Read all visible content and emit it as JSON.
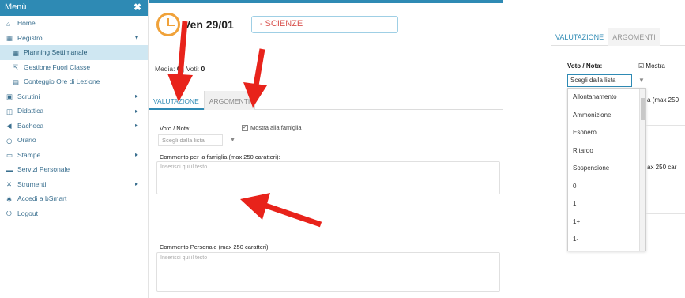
{
  "sidebar": {
    "title": "Menù",
    "close_icon": "close-icon",
    "items": [
      {
        "label": "Home",
        "icon": "home-icon",
        "sub": false,
        "active": false,
        "arrow": false
      },
      {
        "label": "Registro",
        "icon": "calendar-icon",
        "sub": false,
        "active": false,
        "arrow": true,
        "arrow_dir": "down"
      },
      {
        "label": "Planning Settimanale",
        "icon": "calendar-icon",
        "sub": true,
        "active": true,
        "arrow": false
      },
      {
        "label": "Gestione Fuori Classe",
        "icon": "external-link-icon",
        "sub": true,
        "active": false,
        "arrow": false
      },
      {
        "label": "Conteggio Ore di Lezione",
        "icon": "table-icon",
        "sub": true,
        "active": false,
        "arrow": false
      },
      {
        "label": "Scrutini",
        "icon": "document-icon",
        "sub": false,
        "active": false,
        "arrow": true,
        "arrow_dir": "right"
      },
      {
        "label": "Didattica",
        "icon": "book-icon",
        "sub": false,
        "active": false,
        "arrow": true,
        "arrow_dir": "right"
      },
      {
        "label": "Bacheca",
        "icon": "megaphone-icon",
        "sub": false,
        "active": false,
        "arrow": true,
        "arrow_dir": "right"
      },
      {
        "label": "Orario",
        "icon": "clock-icon",
        "sub": false,
        "active": false,
        "arrow": false
      },
      {
        "label": "Stampe",
        "icon": "printer-icon",
        "sub": false,
        "active": false,
        "arrow": true,
        "arrow_dir": "right"
      },
      {
        "label": "Servizi Personale",
        "icon": "folder-icon",
        "sub": false,
        "active": false,
        "arrow": false
      },
      {
        "label": "Strumenti",
        "icon": "tools-icon",
        "sub": false,
        "active": false,
        "arrow": true,
        "arrow_dir": "right"
      },
      {
        "label": "Accedi a bSmart",
        "icon": "star-icon",
        "sub": false,
        "active": false,
        "arrow": false
      },
      {
        "label": "Logout",
        "icon": "logout-icon",
        "sub": false,
        "active": false,
        "arrow": false
      }
    ]
  },
  "header": {
    "date": "Ven 29/01",
    "subject": "- SCIENZE"
  },
  "summary": {
    "media_label": "Media:",
    "media_value": "0",
    "sep": " | ",
    "voti_label": "Voti:",
    "voti_value": "0"
  },
  "tabs": {
    "valutazione": "VALUTAZIONE",
    "argomenti": "ARGOMENTI"
  },
  "form": {
    "voto_label": "Voto / Nota:",
    "mostra_label": "Mostra alla famiglia",
    "select_placeholder": "Scegli dalla lista",
    "commento_famiglia_label": "Commento per la famiglia (max 250 caratteri):",
    "commento_famiglia_placeholder": "Inserisci qui il testo",
    "commento_personale_label": "Commento Personale (max 250 caratteri):",
    "commento_personale_placeholder": "Inserisci qui il testo"
  },
  "right_panel": {
    "tab_valutazione": "VALUTAZIONE",
    "tab_argomenti": "ARGOMENTI",
    "voto_label": "Voto / Nota:",
    "mostra_label": "Mostra",
    "select_value": "Scegli dalla lista",
    "dropdown_options": [
      "Allontanamento",
      "Ammonizione",
      "Esonero",
      "Ritardo",
      "Sospensione",
      "0",
      "1",
      "1+",
      "1-"
    ],
    "partial_label_1": "a (max 250",
    "partial_label_2": "ax 250 car"
  },
  "colors": {
    "accent": "#2e8ab4",
    "active_menu": "#cfe7f2",
    "arrow": "#e8231b",
    "clock": "#f0a23a",
    "subject": "#d9534f"
  }
}
